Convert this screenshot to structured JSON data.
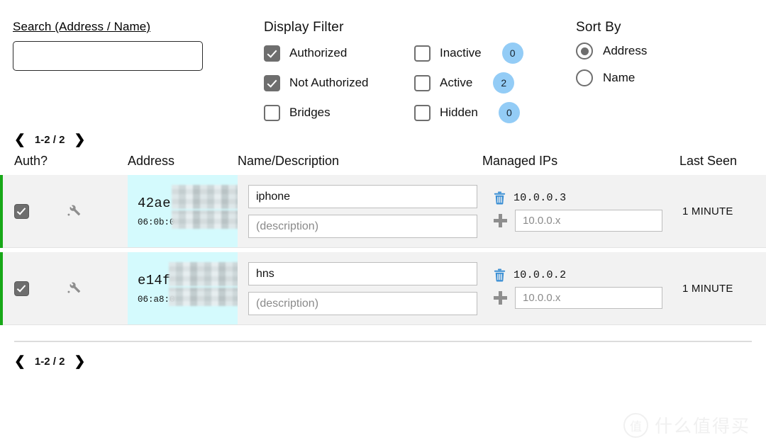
{
  "search": {
    "label": "Search (Address / Name)",
    "value": "",
    "placeholder": ""
  },
  "display_filter": {
    "title": "Display Filter",
    "left_items": [
      {
        "label": "Authorized",
        "checked": true
      },
      {
        "label": "Not Authorized",
        "checked": true
      },
      {
        "label": "Bridges",
        "checked": false
      }
    ],
    "right_items": [
      {
        "label": "Inactive",
        "checked": false,
        "count": "0"
      },
      {
        "label": "Active",
        "checked": false,
        "count": "2"
      },
      {
        "label": "Hidden",
        "checked": false,
        "count": "0"
      }
    ]
  },
  "sort_by": {
    "title": "Sort By",
    "options": [
      {
        "label": "Address",
        "selected": true
      },
      {
        "label": "Name",
        "selected": false
      }
    ]
  },
  "pagination": {
    "prev_icon": "chevron-left-icon",
    "next_icon": "chevron-right-icon",
    "range": "1-2 / 2"
  },
  "table": {
    "headers": {
      "auth": "Auth?",
      "address": "Address",
      "name": "Name/Description",
      "managed_ips": "Managed IPs",
      "last_seen": "Last Seen"
    },
    "rows": [
      {
        "authorized": true,
        "address_main": "42ae",
        "address_sub": "06:0b:0",
        "name_value": "iphone",
        "desc_placeholder": "(description)",
        "managed_ip": "10.0.0.3",
        "new_ip_placeholder": "10.0.0.x",
        "last_seen": "1 MINUTE",
        "status_color": "#18a818"
      },
      {
        "authorized": true,
        "address_main": "e14f",
        "address_sub": "06:a8:0",
        "name_value": "hns",
        "desc_placeholder": "(description)",
        "managed_ip": "10.0.0.2",
        "new_ip_placeholder": "10.0.0.x",
        "last_seen": "1 MINUTE",
        "status_color": "#18a818"
      }
    ]
  },
  "watermark": {
    "mark": "值",
    "text": "什么值得买"
  },
  "colors": {
    "accent_green": "#18a818",
    "badge_blue": "#93ccf6",
    "address_cell": "#d4fafd",
    "row_bg": "#f2f2f2",
    "checkbox_gray": "#6e6e6e",
    "icon_blue": "#3b8fd4"
  }
}
